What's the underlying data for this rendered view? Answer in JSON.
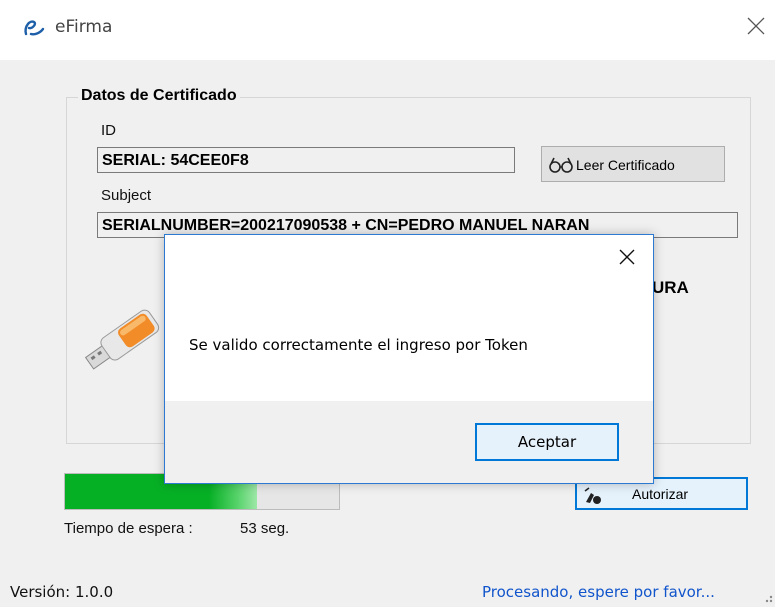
{
  "window": {
    "title": "eFirma"
  },
  "certificate_group": {
    "title": "Datos de Certificado",
    "id_label": "ID",
    "id_value": "SERIAL: 54CEE0F8",
    "read_button": "Leer Certificado",
    "subject_label": "Subject",
    "subject_value": "SERIALNUMBER=200217090538 + CN=PEDRO MANUEL NARAN",
    "partial_heading": "URA"
  },
  "progress": {
    "value_fraction": 0.7
  },
  "authorize_button": "Autorizar",
  "timer": {
    "label": "Tiempo de espera :",
    "value": "53 seg."
  },
  "status_bar": {
    "version": "Versión: 1.0.0",
    "message": "Procesando, espere por favor..."
  },
  "dialog": {
    "message": "Se valido correctamente el ingreso por Token",
    "ok_button": "Aceptar"
  },
  "colors": {
    "accent": "#0078d7",
    "progress": "#06b025",
    "status_link": "#1155cc"
  }
}
